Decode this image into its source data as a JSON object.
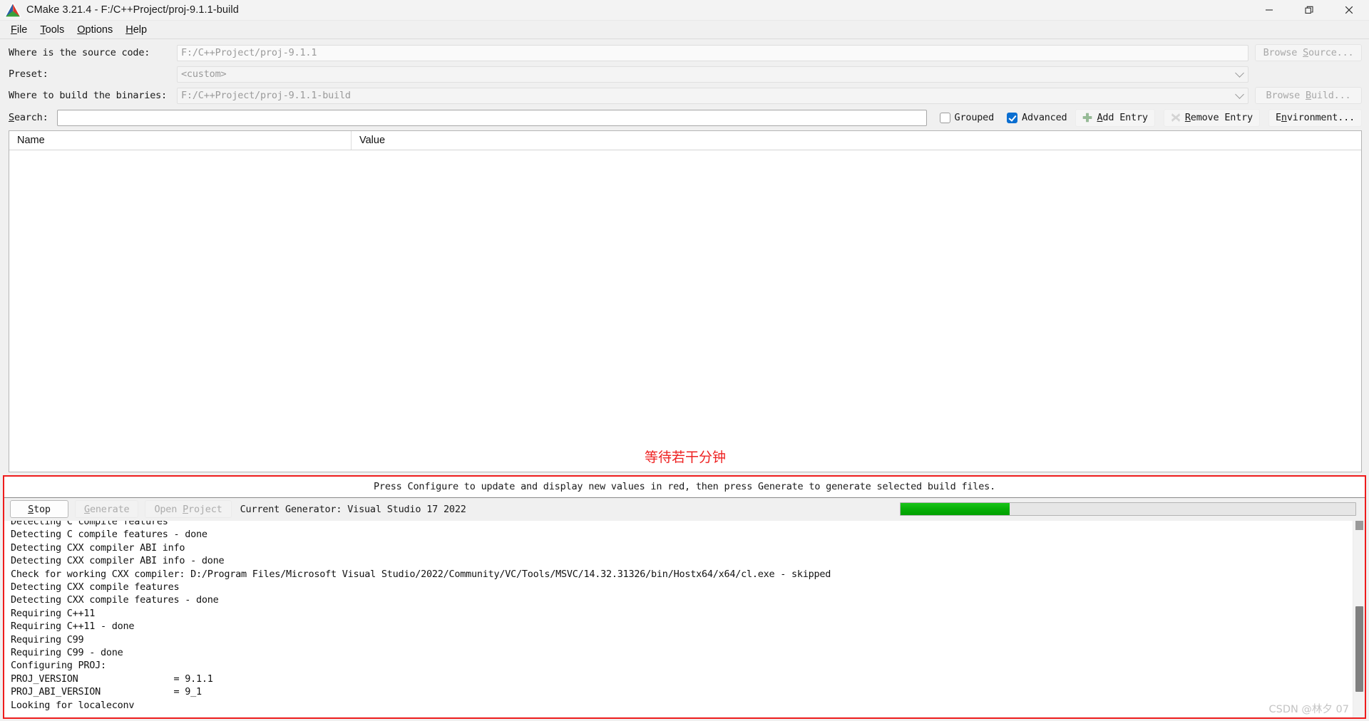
{
  "window": {
    "title": "CMake 3.21.4 - F:/C++Project/proj-9.1.1-build",
    "minimize_label": "—",
    "restore_label": "❐",
    "close_label": "✕"
  },
  "menubar": {
    "items": [
      {
        "label": "File",
        "accel": "F"
      },
      {
        "label": "Tools",
        "accel": "T"
      },
      {
        "label": "Options",
        "accel": "O"
      },
      {
        "label": "Help",
        "accel": "H"
      }
    ]
  },
  "form": {
    "source_label": "Where is the source code:",
    "source_value": "F:/C++Project/proj-9.1.1",
    "browse_source_label": "Browse Source...",
    "preset_label": "Preset:",
    "preset_value": "<custom>",
    "binaries_label": "Where to build the binaries:",
    "binaries_value": "F:/C++Project/proj-9.1.1-build",
    "browse_build_label": "Browse Build..."
  },
  "search": {
    "label": "Search:",
    "value": "",
    "placeholder": "",
    "grouped_label": "Grouped",
    "grouped_checked": false,
    "advanced_label": "Advanced",
    "advanced_checked": true,
    "add_entry_label": "Add Entry",
    "remove_entry_label": "Remove Entry",
    "environment_label": "Environment..."
  },
  "cache_table": {
    "columns": [
      "Name",
      "Value"
    ],
    "rows": []
  },
  "annotation": {
    "note_cn": "等待若干分钟",
    "box_color": "#ee1c1c"
  },
  "status": {
    "message": "Press Configure to update and display new values in red, then press Generate to generate selected build files."
  },
  "actions": {
    "stop_label": "Stop",
    "generate_label": "Generate",
    "open_project_label": "Open Project",
    "generator_text": "Current Generator: Visual Studio 17 2022",
    "progress_percent": 24,
    "progress_color": "#00a000"
  },
  "log": {
    "lines": [
      "Detecting C compile features",
      "Detecting C compile features - done",
      "Detecting CXX compiler ABI info",
      "Detecting CXX compiler ABI info - done",
      "Check for working CXX compiler: D:/Program Files/Microsoft Visual Studio/2022/Community/VC/Tools/MSVC/14.32.31326/bin/Hostx64/x64/cl.exe - skipped",
      "Detecting CXX compile features",
      "Detecting CXX compile features - done",
      "Requiring C++11",
      "Requiring C++11 - done",
      "Requiring C99",
      "Requiring C99 - done",
      "Configuring PROJ:",
      "PROJ_VERSION                 = 9.1.1",
      "PROJ_ABI_VERSION             = 9_1",
      "Looking for localeconv"
    ]
  },
  "watermark": {
    "text": "CSDN @林夕 07"
  }
}
